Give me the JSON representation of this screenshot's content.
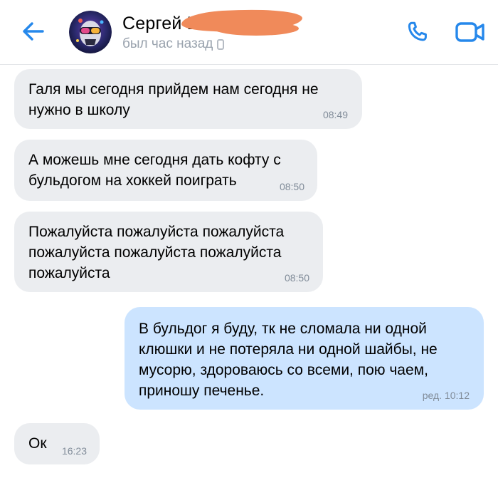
{
  "header": {
    "back_icon": "arrow-left-icon",
    "contact_name": "Сергей Ш",
    "status": "был час назад",
    "status_device_icon": "mobile-phone-icon",
    "call_icon": "phone-icon",
    "video_icon": "video-camera-icon",
    "accent_color": "#2688eb"
  },
  "messages": [
    {
      "direction": "incoming",
      "text": "Галя мы сегодня прийдем нам сегодня не\nнужно в школу",
      "time": "08:49"
    },
    {
      "direction": "incoming",
      "text": "А можешь мне сегодня дать кофту с\nбульдогом на хоккей поиграть",
      "time": "08:50"
    },
    {
      "direction": "incoming",
      "text": "Пожалуйста пожалуйста пожалуйста\nпожалуйста пожалуйста пожалуйста\nпожалуйста",
      "time": "08:50"
    },
    {
      "direction": "outgoing",
      "text": "В бульдог я буду, тк не сломала ни одной\nклюшки и не потеряла ни одной шайбы, не\nмусорю, здороваюсь со всеми, пою чаем,\nприношу печенье.",
      "time": "ред. 10:12"
    },
    {
      "direction": "incoming",
      "text": "Ок",
      "time": "16:23"
    }
  ],
  "colors": {
    "incoming_bubble": "#ebedf0",
    "outgoing_bubble": "#cce4ff",
    "time_text": "#818c99",
    "status_text": "#99a2ad"
  }
}
